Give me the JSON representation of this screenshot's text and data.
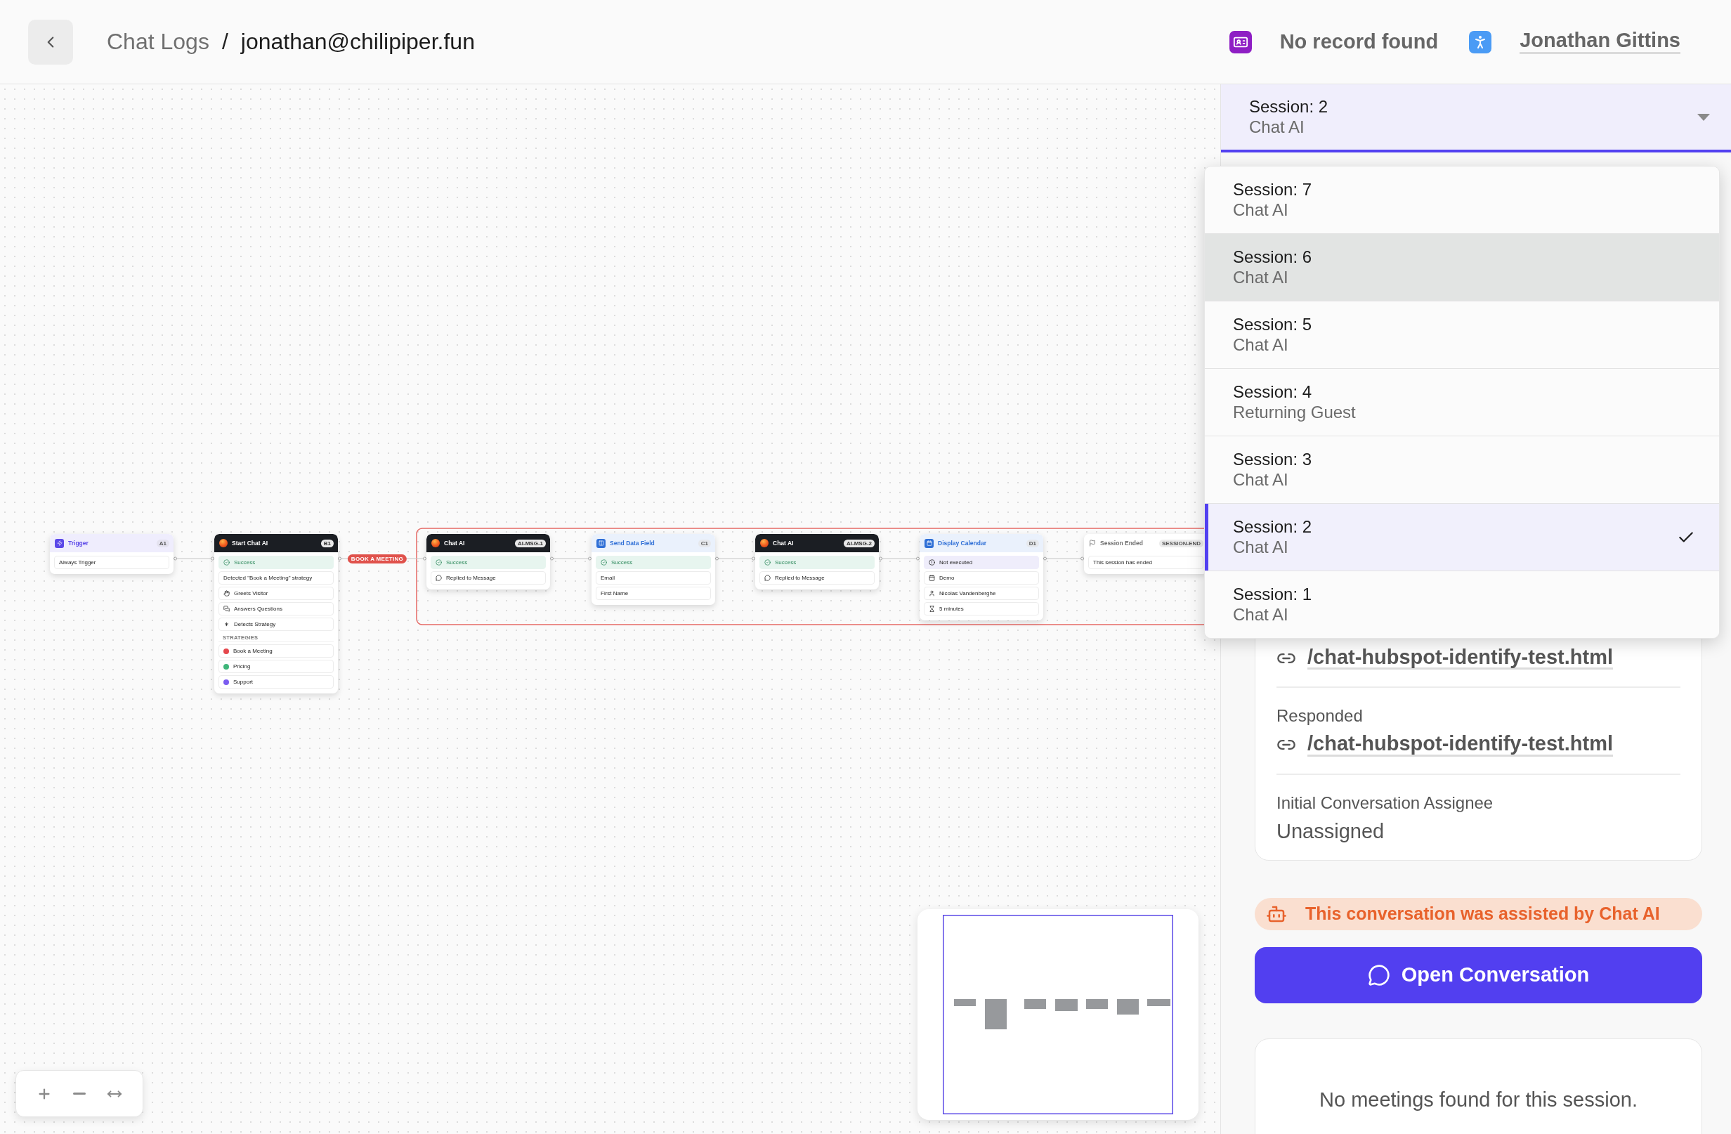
{
  "header": {
    "breadcrumb": {
      "parent": "Chat Logs",
      "separator": "/",
      "current": "jonathan@chilipiper.fun"
    },
    "record": "No record found",
    "contact": "Jonathan Gittins"
  },
  "canvas": {
    "nodes": [
      {
        "kind": "trigger",
        "title": "Trigger",
        "badge": "A1",
        "rows": [
          {
            "kind": "text",
            "text": "Always Trigger"
          }
        ]
      },
      {
        "kind": "ai",
        "title": "Start Chat AI",
        "badge": "B1",
        "rows": [
          {
            "kind": "success",
            "text": "Success"
          },
          {
            "kind": "text",
            "text": "Detected \"Book a Meeting\" strategy"
          },
          {
            "kind": "greeting",
            "text": "Greets Visitor"
          },
          {
            "kind": "questions",
            "text": "Answers Questions"
          },
          {
            "kind": "strategy",
            "text": "Detects Strategy"
          },
          {
            "kind": "heading",
            "text": "STRATEGIES"
          },
          {
            "kind": "option",
            "text": "Book a Meeting",
            "color": "#e5484d"
          },
          {
            "kind": "option",
            "text": "Pricing",
            "color": "#3fb67a"
          },
          {
            "kind": "option",
            "text": "Support",
            "color": "#7b5cf0"
          }
        ]
      },
      {
        "kind": "ai",
        "title": "Chat AI",
        "badge": "AI-MSG-1",
        "incoming_label": "BOOK A MEETING",
        "rows": [
          {
            "kind": "success",
            "text": "Success"
          },
          {
            "kind": "reply",
            "text": "Replied to Message"
          }
        ]
      },
      {
        "kind": "action",
        "title": "Send Data Field",
        "badge": "C1",
        "rows": [
          {
            "kind": "success",
            "text": "Success"
          },
          {
            "kind": "text",
            "text": "Email"
          },
          {
            "kind": "text",
            "text": "First Name"
          }
        ]
      },
      {
        "kind": "ai",
        "title": "Chat AI",
        "badge": "AI-MSG-2",
        "rows": [
          {
            "kind": "success",
            "text": "Success"
          },
          {
            "kind": "reply",
            "text": "Replied to Message"
          }
        ]
      },
      {
        "kind": "calendar",
        "title": "Display Calendar",
        "badge": "D1",
        "rows": [
          {
            "kind": "not_executed",
            "text": "Not executed"
          },
          {
            "kind": "calendar",
            "text": "Demo"
          },
          {
            "kind": "host",
            "text": "Nicolas Vandenberghe"
          },
          {
            "kind": "duration",
            "text": "5 minutes"
          }
        ]
      },
      {
        "kind": "end",
        "title": "Session Ended",
        "badge": "SESSION-END",
        "rows": [
          {
            "kind": "text",
            "text": "This session has ended"
          }
        ]
      }
    ]
  },
  "session_select": {
    "session": "Session: 2",
    "source": "Chat AI",
    "open": true
  },
  "session_menu": [
    {
      "session": "Session: 7",
      "source": "Chat AI",
      "selected": false,
      "highlighted": false
    },
    {
      "session": "Session: 6",
      "source": "Chat AI",
      "selected": false,
      "highlighted": true
    },
    {
      "session": "Session: 5",
      "source": "Chat AI",
      "selected": false,
      "highlighted": false
    },
    {
      "session": "Session: 4",
      "source": "Returning Guest",
      "selected": false,
      "highlighted": false
    },
    {
      "session": "Session: 3",
      "source": "Chat AI",
      "selected": false,
      "highlighted": false
    },
    {
      "session": "Session: 2",
      "source": "Chat AI",
      "selected": true,
      "highlighted": false
    },
    {
      "session": "Session: 1",
      "source": "Chat AI",
      "selected": false,
      "highlighted": false
    }
  ],
  "details": [
    {
      "kind": "link",
      "value": "/chat-hubspot-identify-test.html"
    },
    {
      "kind": "link",
      "label": "Responded",
      "value": "/chat-hubspot-identify-test.html"
    },
    {
      "kind": "text",
      "label": "Initial Conversation Assignee",
      "value": "Unassigned"
    }
  ],
  "ai_banner": "This conversation was assisted by Chat AI",
  "open_button": "Open Conversation",
  "meetings_empty": "No meetings found for this session."
}
